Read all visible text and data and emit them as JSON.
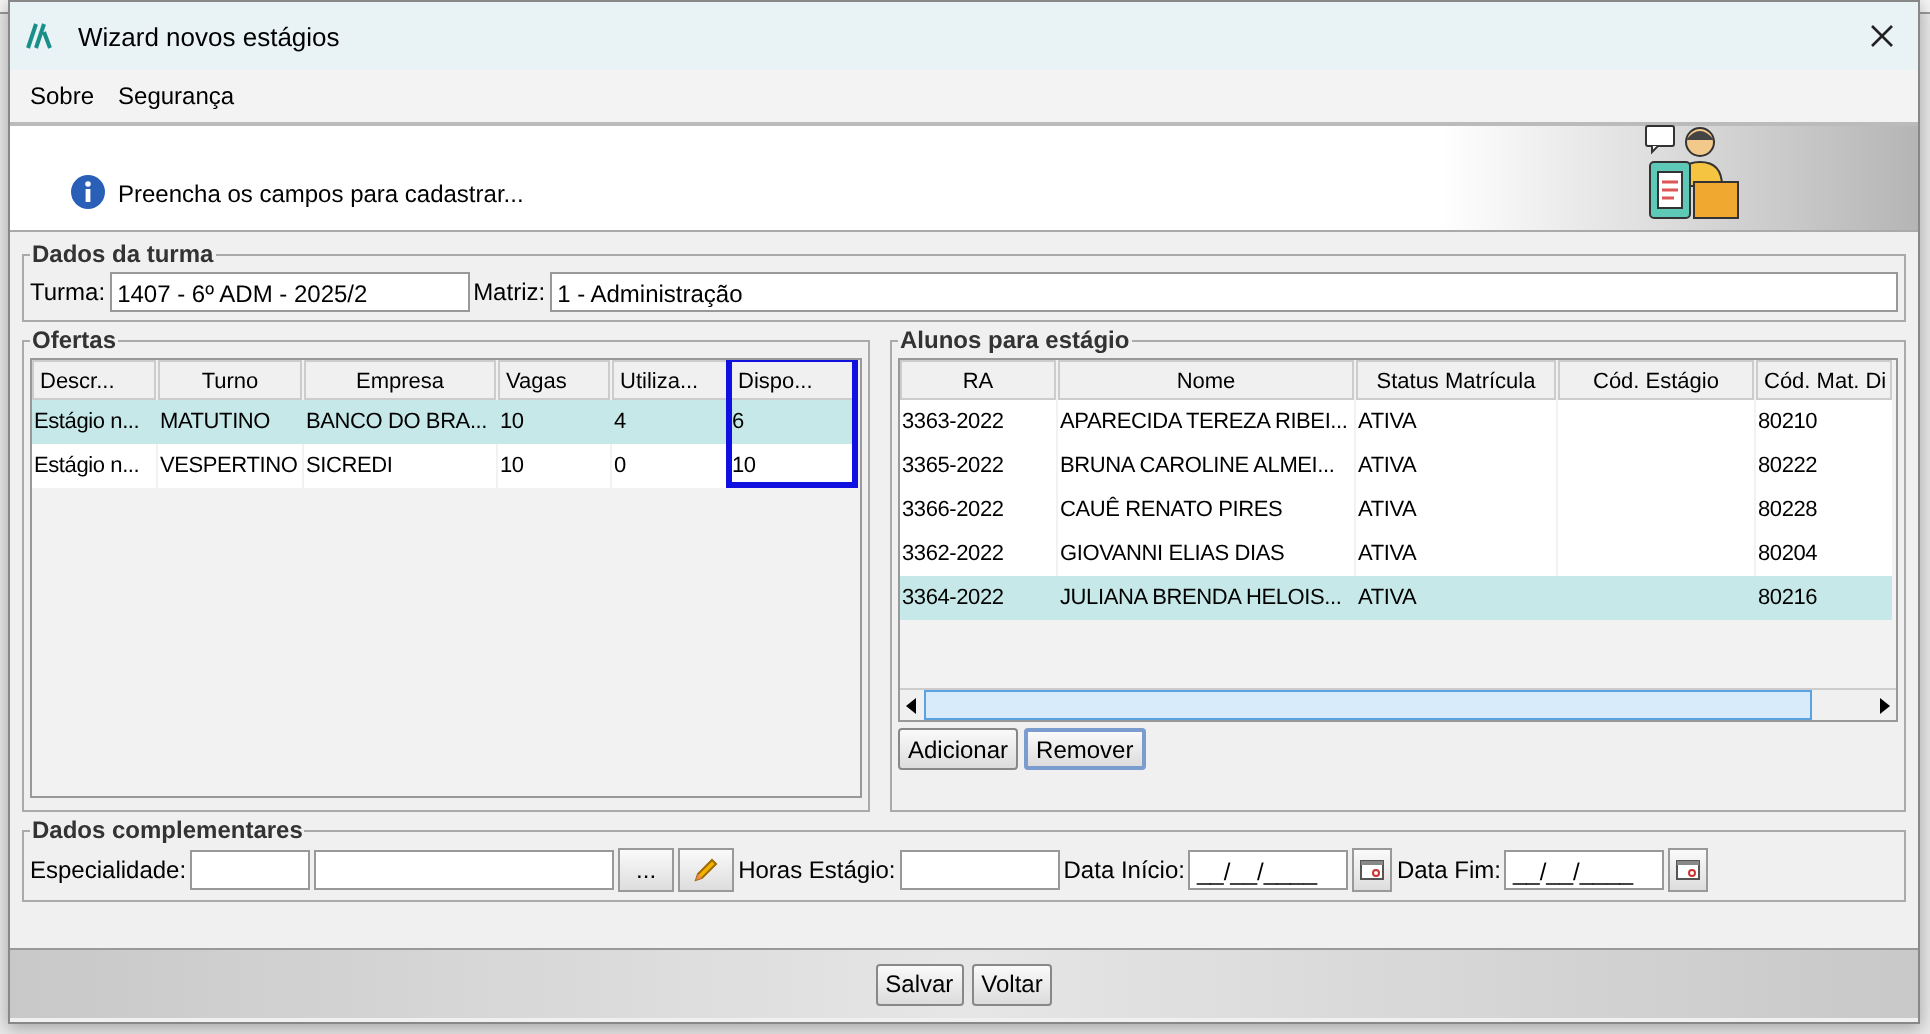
{
  "window": {
    "title": "Wizard novos estágios"
  },
  "menu": [
    {
      "label": "Sobre"
    },
    {
      "label": "Segurança"
    }
  ],
  "header": {
    "message": "Preencha os campos para cadastrar..."
  },
  "dados_turma": {
    "title": "Dados da turma",
    "fields": [
      {
        "label": "Turma:",
        "value": "1407 - 6º ADM - 2025/2"
      },
      {
        "label": "Matriz:",
        "value": "1 - Administração"
      }
    ]
  },
  "ofertas": {
    "title": "Ofertas",
    "columns": [
      {
        "label": "Descr...",
        "highlighted": false
      },
      {
        "label": "Turno",
        "highlighted": false
      },
      {
        "label": "Empresa",
        "highlighted": false
      },
      {
        "label": "Vagas",
        "highlighted": false
      },
      {
        "label": "Utiliza...",
        "highlighted": false
      },
      {
        "label": "Dispo...",
        "highlighted": true
      }
    ],
    "rows": [
      {
        "cells": [
          "Estágio n...",
          "MATUTINO",
          "BANCO DO BRA...",
          "10",
          "4",
          "6"
        ],
        "selected": true
      },
      {
        "cells": [
          "Estágio n...",
          "VESPERTINO",
          "SICREDI",
          "10",
          "0",
          "10"
        ],
        "selected": false
      }
    ]
  },
  "alunos": {
    "title": "Alunos para estágio",
    "columns": [
      "RA",
      "Nome",
      "Status Matrícula",
      "Cód. Estágio",
      "Cód. Mat. Di"
    ],
    "rows": [
      {
        "cells": [
          "3363-2022",
          "APARECIDA TEREZA RIBEI...",
          "ATIVA",
          "",
          "80210"
        ],
        "selected": false
      },
      {
        "cells": [
          "3365-2022",
          "BRUNA CAROLINE ALMEI...",
          "ATIVA",
          "",
          "80222"
        ],
        "selected": false
      },
      {
        "cells": [
          "3366-2022",
          "CAUÊ RENATO PIRES",
          "ATIVA",
          "",
          "80228"
        ],
        "selected": false
      },
      {
        "cells": [
          "3362-2022",
          "GIOVANNI ELIAS DIAS",
          "ATIVA",
          "",
          "80204"
        ],
        "selected": false
      },
      {
        "cells": [
          "3364-2022",
          "JULIANA BRENDA HELOIS...",
          "ATIVA",
          "",
          "80216"
        ],
        "selected": true
      }
    ],
    "buttons": [
      {
        "label": "Adicionar",
        "focused": false
      },
      {
        "label": "Remover",
        "focused": true
      }
    ]
  },
  "complementares": {
    "title": "Dados complementares",
    "fields": [
      {
        "kind": "lookup",
        "label": "Especialidade:",
        "button": "..."
      },
      {
        "kind": "text",
        "label": "Horas Estágio:"
      },
      {
        "kind": "date",
        "label": "Data Início:",
        "value": "__/__/____"
      },
      {
        "kind": "date",
        "label": "Data Fim:",
        "value": "__/__/____"
      }
    ]
  },
  "footer_buttons": [
    {
      "label": "Salvar"
    },
    {
      "label": "Voltar"
    }
  ]
}
